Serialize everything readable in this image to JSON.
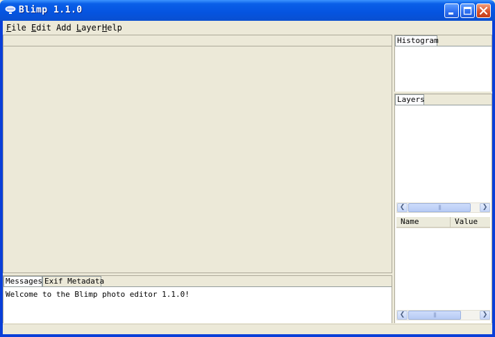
{
  "window": {
    "title": "Blimp 1.1.0",
    "icon": "blimp-app-icon",
    "controls": [
      "minimize-icon",
      "maximize-icon",
      "close-icon"
    ]
  },
  "menu": {
    "items": [
      {
        "label": "File",
        "mnemonic": "F",
        "rest": "ile"
      },
      {
        "label": "Edit",
        "mnemonic": "E",
        "rest": "dit"
      },
      {
        "label": "Add Layer",
        "prefix": "Add ",
        "mnemonic": "L",
        "rest": "ayer"
      },
      {
        "label": "Help",
        "mnemonic": "H",
        "rest": "elp"
      }
    ]
  },
  "messages": {
    "tabs": [
      "Messages",
      "Exif Metadata"
    ],
    "text": "Welcome to the Blimp photo editor 1.1.0!"
  },
  "histogram": {
    "tab": "Histogram"
  },
  "layers": {
    "tab": "Layers",
    "columns": [
      "Name",
      "Value"
    ]
  },
  "colors": {
    "title_bar": "#0554e0",
    "frame": "#0a3fd8",
    "window_bg": "#ece9d8",
    "close_button": "#d9532c"
  }
}
